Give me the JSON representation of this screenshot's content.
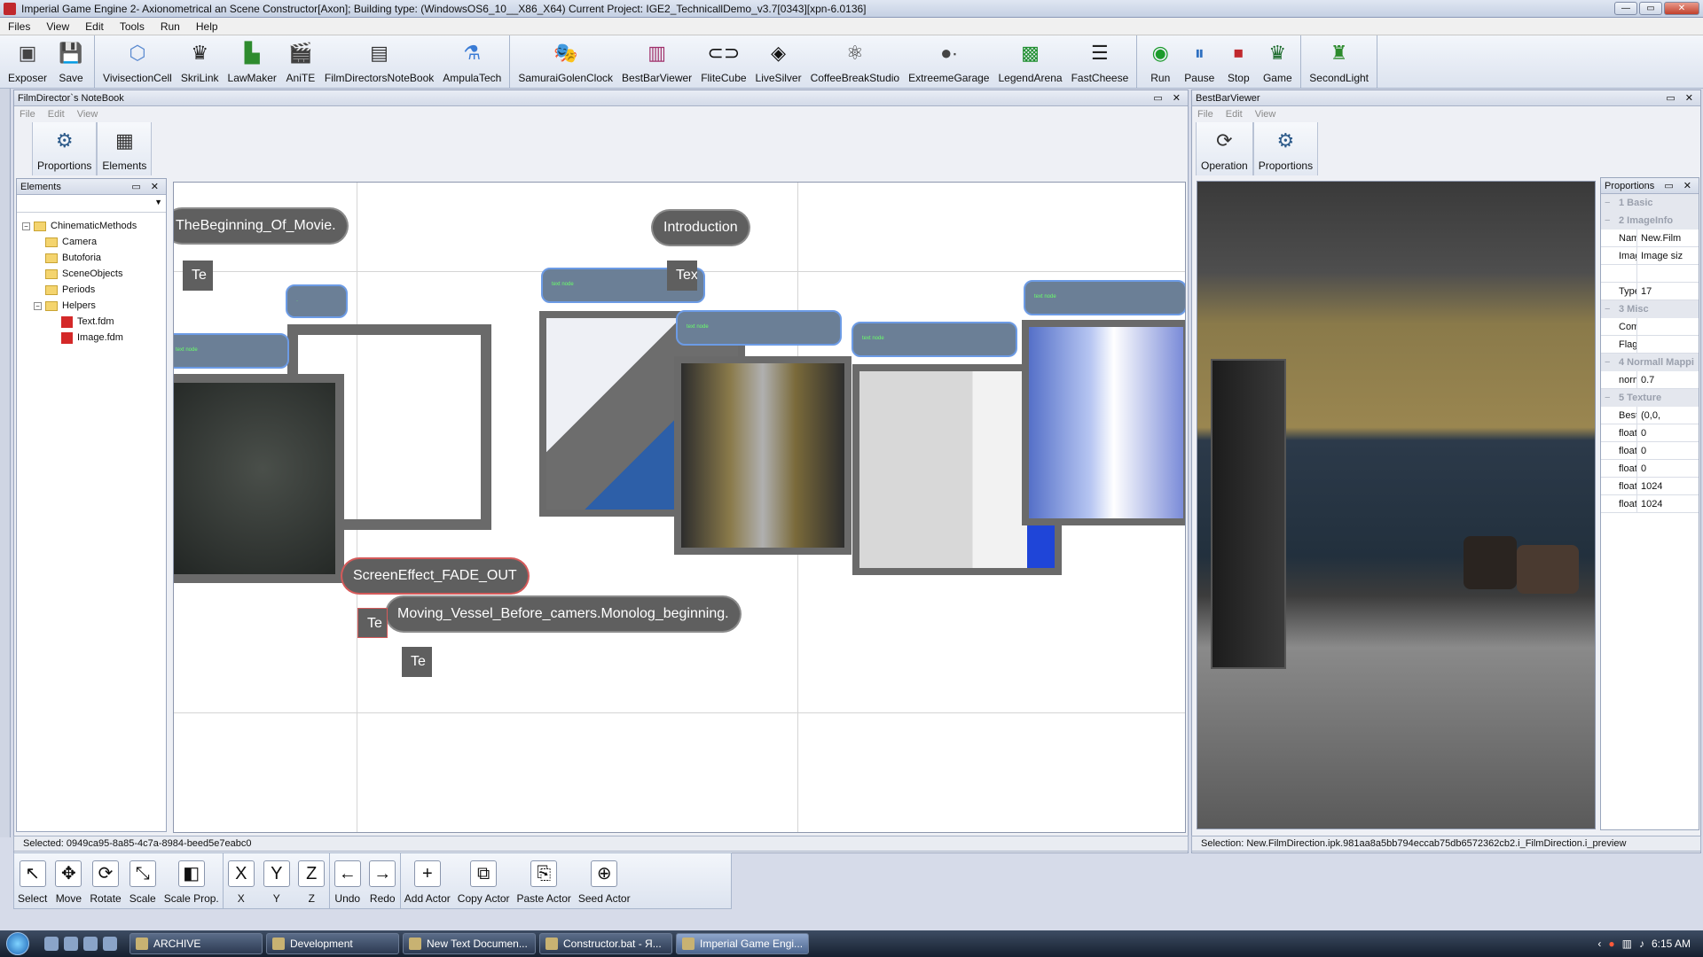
{
  "window": {
    "title": "Imperial Game Engine 2- Axionometrical an Scene Constructor[Axon]; Building type: (WindowsOS6_10__X86_X64) Current Project: IGE2_TechnicallDemo_v3.7[0343][xpn-6.0136]"
  },
  "menu": [
    "Files",
    "View",
    "Edit",
    "Tools",
    "Run",
    "Help"
  ],
  "toolbar": {
    "group1": [
      {
        "label": "Exposer",
        "icon": "exposer-icon"
      },
      {
        "label": "Save",
        "icon": "save-icon"
      }
    ],
    "group2": [
      {
        "label": "VivisectionCell",
        "icon": "cube-icon"
      },
      {
        "label": "SkriLink",
        "icon": "eagle-icon"
      },
      {
        "label": "LawMaker",
        "icon": "lawmaker-icon"
      },
      {
        "label": "AniTE",
        "icon": "clapper-icon"
      },
      {
        "label": "FilmDirectorsNoteBook",
        "icon": "notebook-icon"
      },
      {
        "label": "AmpulaTech",
        "icon": "ampula-icon"
      }
    ],
    "group3": [
      {
        "label": "SamuraiGolenClock",
        "icon": "masks-icon"
      },
      {
        "label": "BestBarViewer",
        "icon": "viewer-icon"
      },
      {
        "label": "FliteCube",
        "icon": "flitecube-icon"
      },
      {
        "label": "LiveSilver",
        "icon": "diamond-icon"
      },
      {
        "label": "CoffeeBreakStudio",
        "icon": "atom-icon"
      },
      {
        "label": "ExtreemeGarage",
        "icon": "dots-icon"
      },
      {
        "label": "LegendArena",
        "icon": "arena-icon"
      },
      {
        "label": "FastCheese",
        "icon": "sliders-icon"
      }
    ],
    "group4": [
      {
        "label": "Run",
        "icon": "run-icon"
      },
      {
        "label": "Pause",
        "icon": "pause-icon"
      },
      {
        "label": "Stop",
        "icon": "stop-icon"
      },
      {
        "label": "Game",
        "icon": "game-eagle-icon"
      }
    ],
    "group5": [
      {
        "label": "SecondLight",
        "icon": "secondlight-icon"
      }
    ]
  },
  "notebook": {
    "title": "FilmDirector`s NoteBook",
    "menu": [
      "File",
      "Edit",
      "View"
    ],
    "tools": [
      {
        "label": "Proportions",
        "icon": "gear-icon"
      },
      {
        "label": "Elements",
        "icon": "elements-icon"
      }
    ],
    "elements_panel": {
      "title": "Elements",
      "tree": [
        {
          "label": "ChinematicMethods",
          "type": "folder",
          "level": 0
        },
        {
          "label": "Camera",
          "type": "folder",
          "level": 1
        },
        {
          "label": "Butoforia",
          "type": "folder",
          "level": 1
        },
        {
          "label": "SceneObjects",
          "type": "folder",
          "level": 1
        },
        {
          "label": "Periods",
          "type": "folder",
          "level": 1
        },
        {
          "label": "Helpers",
          "type": "folder",
          "level": 1
        },
        {
          "label": "Text.fdm",
          "type": "file",
          "level": 2
        },
        {
          "label": "Image.fdm",
          "type": "file",
          "level": 2
        }
      ]
    },
    "canvas": {
      "bubbles": {
        "beginning": "TheBeginning_Of_Movie.",
        "introduction": "Introduction",
        "fade_out": "ScreenEffect_FADE_OUT",
        "monolog": "Moving_Vessel_Before_camers.Monolog_beginning."
      },
      "te_labels": {
        "te1": "Te",
        "te2": "Tex",
        "te3": "Te",
        "te4": "Te"
      }
    },
    "status": "Selected:   0949ca95-8a85-4c7a-8984-beed5e7eabc0"
  },
  "viewer": {
    "title": "BestBarViewer",
    "menu": [
      "File",
      "Edit",
      "View"
    ],
    "tools": [
      {
        "label": "Operation",
        "icon": "operation-icon"
      },
      {
        "label": "Proportions",
        "icon": "gear-icon"
      }
    ],
    "status": "Selection: New.FilmDirection.ipk.981aa8a5bb794eccab75db6572362cb2.i_FilmDirection.i_preview",
    "proportions": {
      "title": "Proportions",
      "sections": [
        {
          "name": "1 Basic",
          "rows": []
        },
        {
          "name": "2 ImageInfo",
          "rows": [
            {
              "key": "Name:",
              "value": "New.Film"
            },
            {
              "key": "Image",
              "value": "Image siz"
            },
            {
              "key": "",
              "value": ""
            },
            {
              "key": "Type:",
              "value": "17"
            }
          ]
        },
        {
          "name": "3 Misc",
          "rows": [
            {
              "key": "Comm",
              "value": ""
            },
            {
              "key": "Flag:",
              "value": ""
            }
          ]
        },
        {
          "name": "4 Normall Mappi",
          "rows": [
            {
              "key": "norma",
              "value": "0.7"
            }
          ]
        },
        {
          "name": "5 Texture",
          "rows": [
            {
              "key": "BestBa",
              "value": "(0,0,"
            },
            {
              "key": "float_E",
              "value": "0"
            },
            {
              "key": "float_E",
              "value": "0"
            },
            {
              "key": "float_E",
              "value": "0"
            },
            {
              "key": "float_E",
              "value": "1024"
            },
            {
              "key": "float_E",
              "value": "1024"
            }
          ]
        }
      ]
    }
  },
  "bottom_toolbar": [
    {
      "label": "Select",
      "icon": "cursor-icon",
      "glyph": "↖"
    },
    {
      "label": "Move",
      "icon": "move-icon",
      "glyph": "✥"
    },
    {
      "label": "Rotate",
      "icon": "rotate-icon",
      "glyph": "⟳"
    },
    {
      "label": "Scale",
      "icon": "scale-icon",
      "glyph": "⤡"
    },
    {
      "label": "Scale Prop.",
      "icon": "scale-prop-icon",
      "glyph": "◧"
    },
    {
      "label": "X",
      "icon": "x-axis-icon",
      "glyph": "X"
    },
    {
      "label": "Y",
      "icon": "y-axis-icon",
      "glyph": "Y"
    },
    {
      "label": "Z",
      "icon": "z-axis-icon",
      "glyph": "Z"
    },
    {
      "label": "Undo",
      "icon": "undo-icon",
      "glyph": "←"
    },
    {
      "label": "Redo",
      "icon": "redo-icon",
      "glyph": "→"
    },
    {
      "label": "Add Actor",
      "icon": "add-actor-icon",
      "glyph": "+"
    },
    {
      "label": "Copy Actor",
      "icon": "copy-actor-icon",
      "glyph": "⧉"
    },
    {
      "label": "Paste Actor",
      "icon": "paste-actor-icon",
      "glyph": "⎘"
    },
    {
      "label": "Seed Actor",
      "icon": "seed-actor-icon",
      "glyph": "⊕"
    }
  ],
  "taskbar": {
    "tasks": [
      {
        "label": "ARCHIVE"
      },
      {
        "label": "Development"
      },
      {
        "label": "New Text Documen..."
      },
      {
        "label": "Constructor.bat - Я..."
      },
      {
        "label": "Imperial Game Engi..."
      }
    ],
    "clock": "6:15 AM"
  },
  "colors": {
    "accent": "#6c9be5",
    "bubble": "#5f5f5f",
    "fade_out_border": "#d45a5a"
  }
}
